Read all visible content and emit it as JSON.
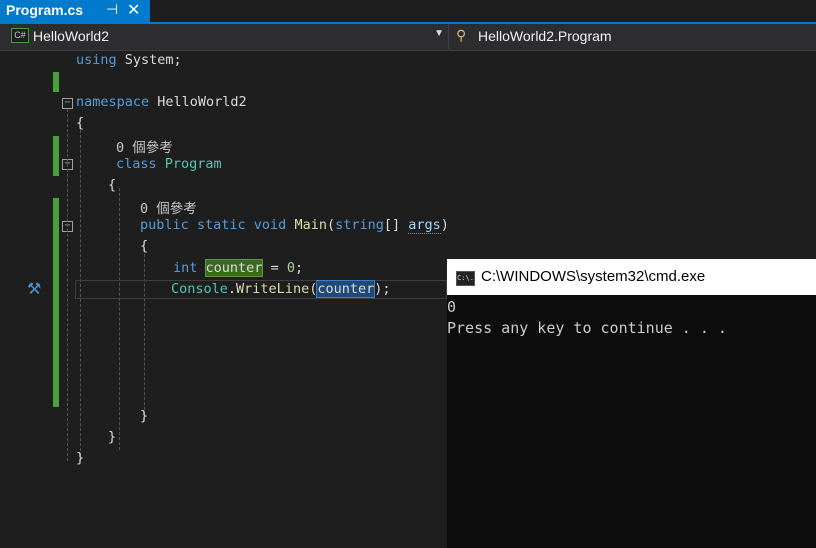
{
  "tab": {
    "title": "Program.cs",
    "pin_icon": "pin-icon",
    "close_icon": "close-icon"
  },
  "navbar": {
    "project_badge": "C#",
    "project": "HelloWorld2",
    "class_member": "HelloWorld2.Program"
  },
  "code": {
    "l1_kw": "using",
    "l1_rest": " System;",
    "l3_kw": "namespace",
    "l3_rest": " HelloWorld2",
    "brace_open": "{",
    "brace_close": "}",
    "refs": "0 個參考",
    "l6_kw": "class",
    "l6_type": "Program",
    "l9_mods": "public static void",
    "l9_name": "Main",
    "l9_p1": "(",
    "l9_ptype": "string",
    "l9_p2": "[] ",
    "l9_arg": "args",
    "l9_p3": ")",
    "l11_type": "int",
    "l11_var": "counter",
    "l11_eq": " = ",
    "l11_num": "0",
    "l11_semi": ";",
    "l12_cls": "Console",
    "l12_dot": ".",
    "l12_meth": "WriteLine",
    "l12_p1": "(",
    "l12_arg": "counter",
    "l12_p2": ");"
  },
  "console": {
    "title": "C:\\WINDOWS\\system32\\cmd.exe",
    "icon_text": "C:\\.",
    "output_line1": "0",
    "output_line2": "Press any key to continue . . ."
  },
  "colors": {
    "accent": "#007acc",
    "keyword": "#569cd6",
    "type": "#4ec9b0",
    "method": "#dcdcaa",
    "change_bar": "#4aa03b"
  }
}
